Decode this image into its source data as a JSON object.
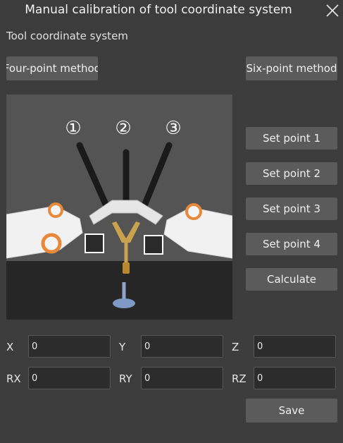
{
  "window": {
    "title": "Manual calibration of tool coordinate system"
  },
  "section_title": "Tool coordinate system",
  "methods": {
    "four_point": "Four-point method",
    "six_point": "Six-point method"
  },
  "point_buttons": [
    "Set point 1",
    "Set point 2",
    "Set point 3",
    "Set point 4"
  ],
  "calculate_label": "Calculate",
  "illustration": {
    "markers": [
      "①",
      "②",
      "③"
    ]
  },
  "fields": [
    {
      "label": "X",
      "value": "0"
    },
    {
      "label": "Y",
      "value": "0"
    },
    {
      "label": "Z",
      "value": "0"
    },
    {
      "label": "RX",
      "value": "0"
    },
    {
      "label": "RY",
      "value": "0"
    },
    {
      "label": "RZ",
      "value": "0"
    }
  ],
  "save_label": "Save",
  "colors": {
    "background": "#3c3c3c",
    "button": "#5b5b5b",
    "field": "#2c2c2c",
    "accent_orange": "#e8893a"
  }
}
